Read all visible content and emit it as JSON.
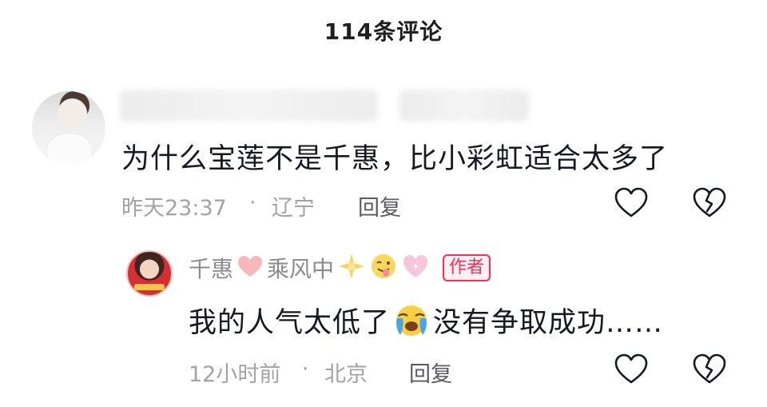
{
  "header": {
    "title": "114条评论"
  },
  "comment": {
    "text": "为什么宝莲不是千惠，比小彩虹适合太多了",
    "time": "昨天23:37",
    "separator": "·",
    "location": "辽宁",
    "reply_label": "回复"
  },
  "reply": {
    "author_part1": "千惠",
    "author_part2": "乘风中",
    "badge": "作者",
    "text_before": "我的人气太低了",
    "text_after": "没有争取成功……",
    "time": "12小时前",
    "separator": "·",
    "location": "北京",
    "reply_label": "回复"
  },
  "icons": {
    "like": "heart-outline-icon",
    "dislike": "broken-heart-icon",
    "crying_emoji": "crying-face-emoji",
    "pink_heart": "pink-heart-emoji",
    "star": "sparkle-star-emoji",
    "tongue": "tongue-out-face-emoji",
    "sparkling_heart": "sparkling-heart-emoji"
  },
  "colors": {
    "badge": "#ff2c55",
    "meta": "#a3a3a6",
    "text": "#161823"
  }
}
